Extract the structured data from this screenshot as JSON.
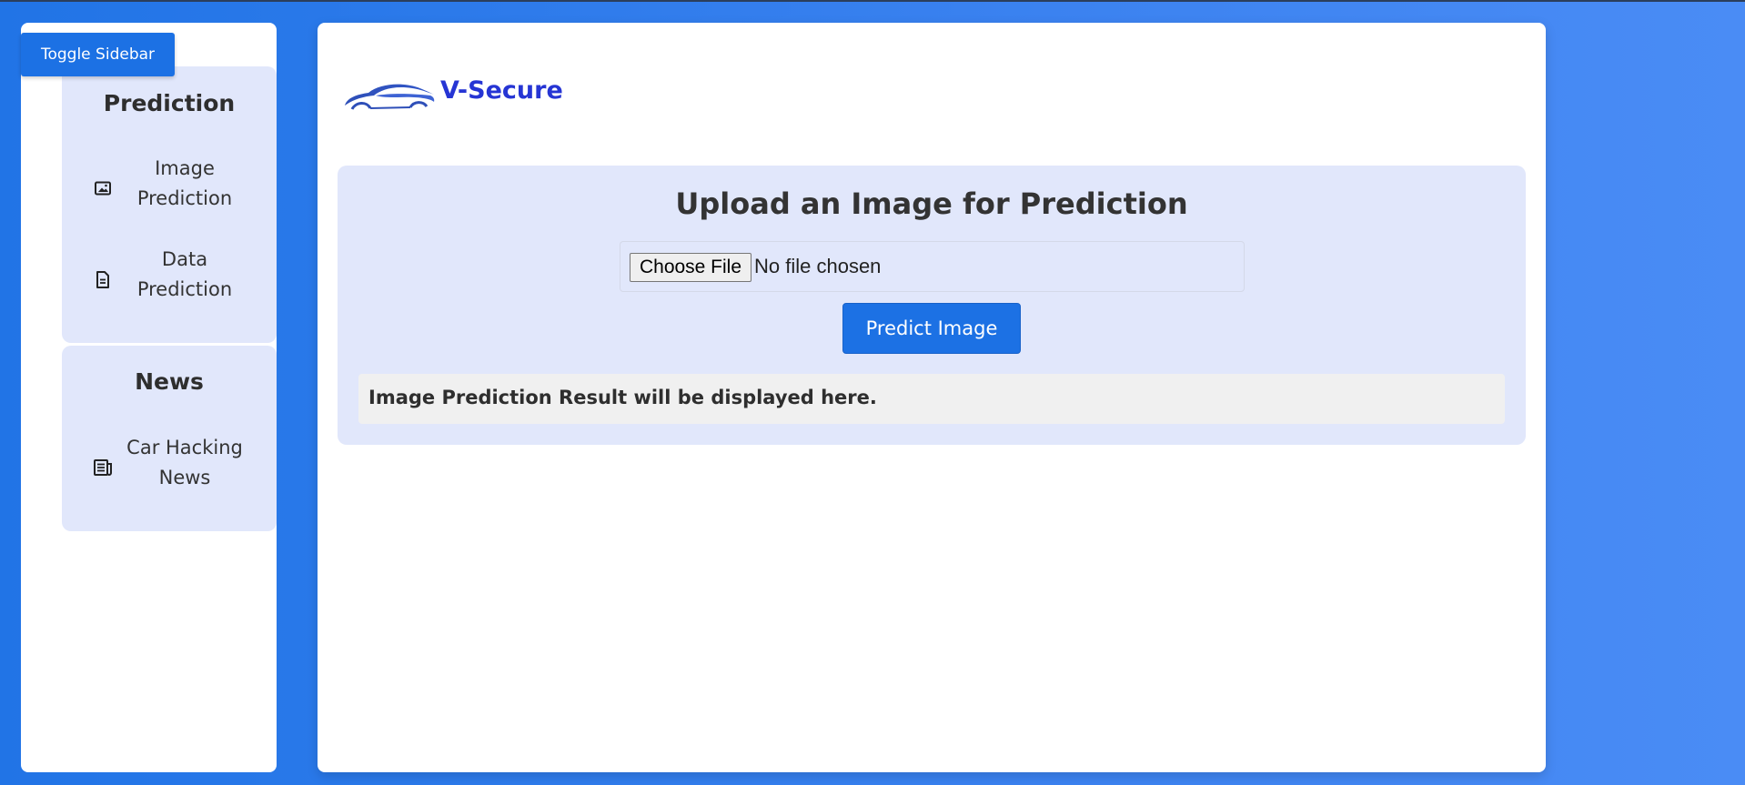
{
  "toggle_sidebar_label": "Toggle Sidebar",
  "sidebar": {
    "sections": [
      {
        "title": "Prediction",
        "items": [
          {
            "label_line1": "Image",
            "label_line2": "Prediction",
            "icon": "image-icon"
          },
          {
            "label_line1": "Data",
            "label_line2": "Prediction",
            "icon": "document-icon"
          }
        ]
      },
      {
        "title": "News",
        "items": [
          {
            "label_line1": "Car Hacking",
            "label_line2": "News",
            "icon": "newspaper-icon"
          }
        ]
      }
    ]
  },
  "header": {
    "logo_icon": "car-logo-icon",
    "brand_name": "V-Secure"
  },
  "upload": {
    "title": "Upload an Image for Prediction",
    "choose_file_label": "Choose File",
    "no_file_text": "No file chosen",
    "predict_button_label": "Predict Image",
    "result_placeholder": "Image Prediction Result will be displayed here."
  },
  "colors": {
    "accent": "#1c71e4",
    "brand": "#2635d4",
    "card_bg": "#e1e7fb",
    "page_bg": "#2174e6"
  }
}
